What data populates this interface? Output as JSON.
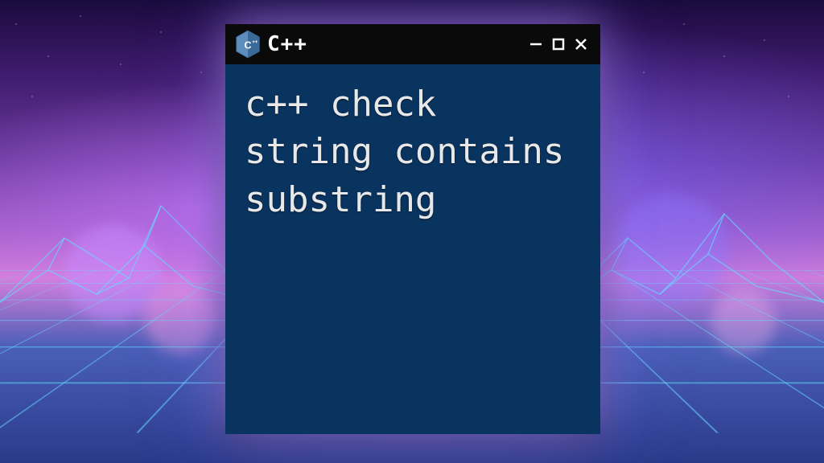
{
  "window": {
    "title": "C++",
    "logo_label": "C++"
  },
  "terminal": {
    "content": "c++ check string contains substring"
  },
  "colors": {
    "terminal_bg": "#0a3460",
    "titlebar_bg": "#0a0a0a",
    "text": "#e8e8e8",
    "logo_blue": "#5c8dbc"
  }
}
